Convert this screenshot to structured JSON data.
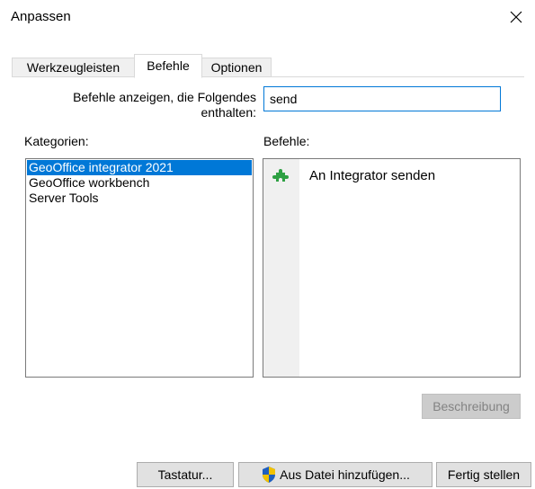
{
  "window": {
    "title": "Anpassen"
  },
  "tabs": [
    {
      "label": "Werkzeugleisten",
      "active": false
    },
    {
      "label": "Befehle",
      "active": true
    },
    {
      "label": "Optionen",
      "active": false
    }
  ],
  "filter": {
    "label_line1": "Befehle anzeigen, die Folgendes",
    "label_line2": "enthalten:",
    "value": "send"
  },
  "categories": {
    "label": "Kategorien:",
    "items": [
      {
        "label": "GeoOffice integrator 2021",
        "selected": true
      },
      {
        "label": "GeoOffice workbench",
        "selected": false
      },
      {
        "label": "Server Tools",
        "selected": false
      }
    ]
  },
  "commands": {
    "label": "Befehle:",
    "items": [
      {
        "label": "An Integrator senden",
        "icon": "puzzle-icon"
      }
    ]
  },
  "buttons": {
    "description": "Beschreibung",
    "keyboard": "Tastatur...",
    "add_from_file": "Aus Datei hinzufügen...",
    "finish": "Fertig stellen"
  },
  "colors": {
    "selection": "#0078d7",
    "focus_border": "#0078d7",
    "icon_green": "#2ea043",
    "shield_blue": "#1f5fbf",
    "shield_yellow": "#f2c200"
  }
}
